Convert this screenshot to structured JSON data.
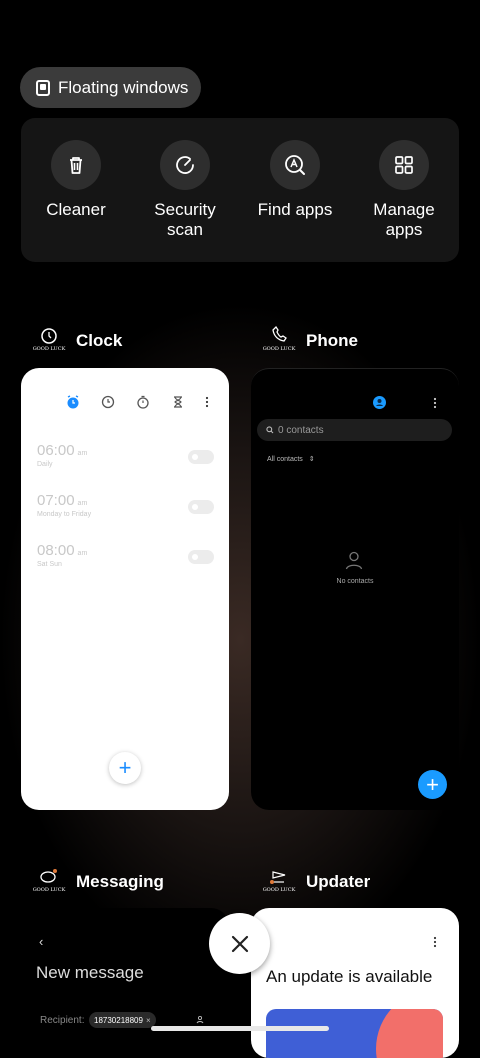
{
  "floating_windows": {
    "label": "Floating windows",
    "icon": "floating-window-icon"
  },
  "tools": [
    {
      "label": "Cleaner",
      "icon": "trash-icon"
    },
    {
      "label": "Security\nscan",
      "icon": "security-scan-icon"
    },
    {
      "label": "Find apps",
      "icon": "find-apps-icon"
    },
    {
      "label": "Manage\napps",
      "icon": "grid-icon"
    }
  ],
  "logo_text": "GOOD LUCK",
  "apps": {
    "clock": {
      "name": "Clock",
      "accent": "#1a8cff",
      "alarms": [
        {
          "time": "06:00",
          "ampm": "am",
          "repeat": "Daily"
        },
        {
          "time": "07:00",
          "ampm": "am",
          "repeat": "Monday to Friday"
        },
        {
          "time": "08:00",
          "ampm": "am",
          "repeat": "Sat Sun"
        }
      ],
      "add_label": "+"
    },
    "phone": {
      "name": "Phone",
      "search_placeholder": "0 contacts",
      "filter_label": "All contacts",
      "empty_label": "No contacts",
      "fab_label": "+",
      "accent": "#1a9bff"
    },
    "messaging": {
      "name": "Messaging",
      "title": "New message",
      "recipient_label": "Recipient:",
      "recipient_chip": "18730218809"
    },
    "updater": {
      "name": "Updater",
      "headline": "An update is available"
    }
  }
}
